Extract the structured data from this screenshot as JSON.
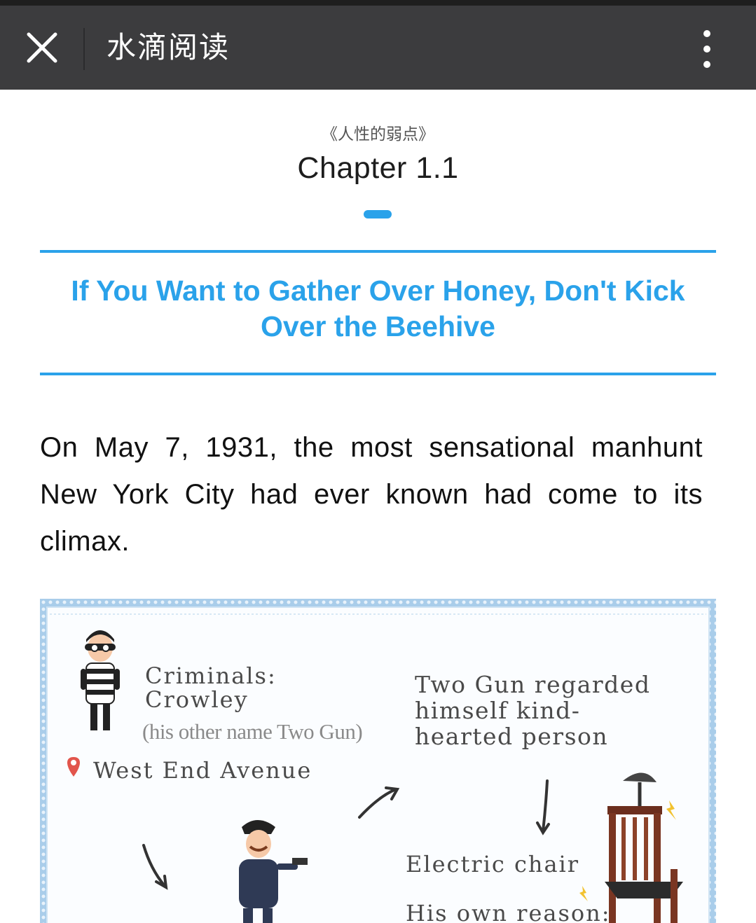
{
  "app": {
    "title": "水滴阅读",
    "close_icon": "close-icon",
    "more_icon": "more-vertical-icon"
  },
  "chapter": {
    "book_name": "《人性的弱点》",
    "title": "Chapter 1.1",
    "heading": "If You Want to Gather Over Honey, Don't Kick Over the Beehive"
  },
  "article": {
    "paragraph": "On May 7, 1931, the most sensational manhunt New York City had ever known had come to its climax."
  },
  "illustration": {
    "criminals_label": "Criminals:",
    "criminal_name": "Crowley",
    "other_name": "(his other name Two Gun)",
    "location": "West End Avenue",
    "regarded": "Two Gun regarded himself kind-hearted person",
    "electric_chair": "Electric chair",
    "own_reason": "His own reason:"
  },
  "colors": {
    "accent": "#2aa2ea",
    "nav_bg": "#3c3c3e",
    "frame_blue": "#8fc0e6"
  }
}
